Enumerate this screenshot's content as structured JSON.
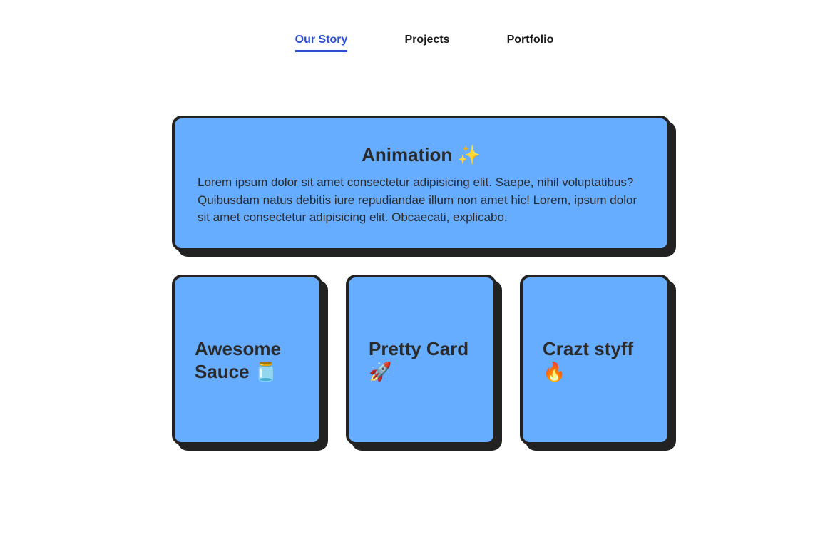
{
  "nav": {
    "items": [
      {
        "label": "Our Story",
        "active": true
      },
      {
        "label": "Projects",
        "active": false
      },
      {
        "label": "Portfolio",
        "active": false
      }
    ],
    "active_color": "#2b4fd1"
  },
  "hero_card": {
    "title": "Animation ✨",
    "body": "Lorem ipsum dolor sit amet consectetur adipisicing elit. Saepe, nihil voluptatibus? Quibusdam natus debitis iure repudiandae illum non amet hic! Lorem, ipsum dolor sit amet consectetur adipisicing elit. Obcaecati, explicabo."
  },
  "cards": [
    {
      "title": "Awesome Sauce 🫙"
    },
    {
      "title": "Pretty Card 🚀"
    },
    {
      "title": "Crazt styff 🔥"
    }
  ],
  "colors": {
    "card_background": "#66adff",
    "card_border": "#222222"
  }
}
